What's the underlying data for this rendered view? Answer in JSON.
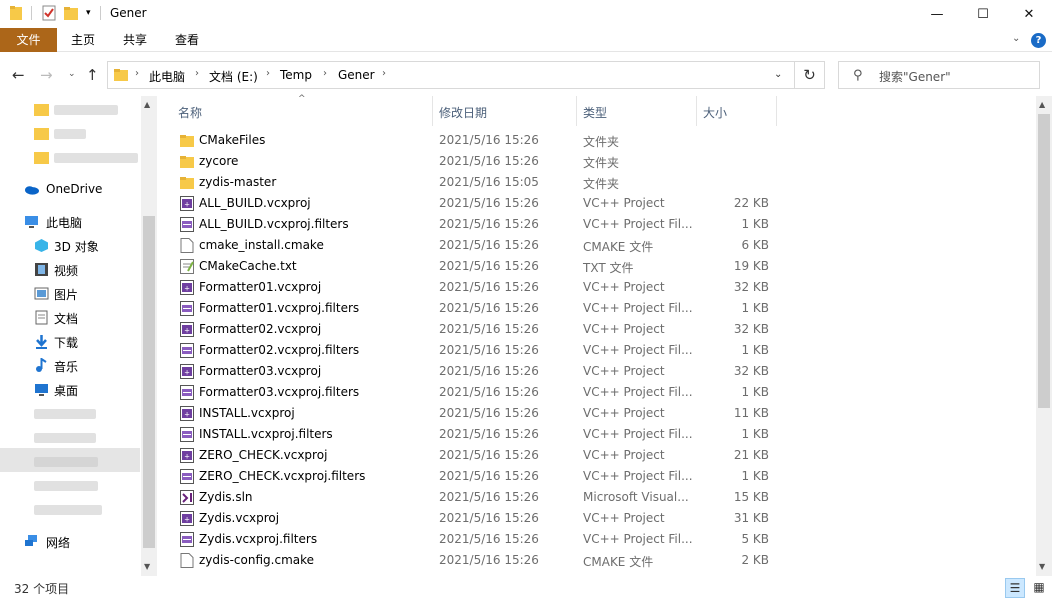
{
  "window": {
    "title": "Gener",
    "minimize": "—",
    "maximize": "☐",
    "close": "✕",
    "dropdown_glyph": "▾"
  },
  "ribbon": {
    "tabs": [
      "文件",
      "主页",
      "共享",
      "查看"
    ],
    "expand_glyph": "⌄",
    "help": "?"
  },
  "nav": {
    "back": "←",
    "forward": "→",
    "recent": "⌄",
    "up": "↑",
    "refresh": "↻",
    "breadcrumb": [
      "此电脑",
      "文档 (E:)",
      "Temp",
      "Gener"
    ],
    "crumb_sep": "›",
    "address_dropdown": "⌄"
  },
  "search": {
    "placeholder": "搜索\"Gener\""
  },
  "navpane": {
    "items": [
      {
        "label": "OneDrive",
        "icon": "onedrive-icon"
      },
      {
        "label": "此电脑",
        "icon": "this-pc-icon"
      },
      {
        "label": "3D 对象",
        "icon": "3d-objects-icon"
      },
      {
        "label": "视频",
        "icon": "videos-icon"
      },
      {
        "label": "图片",
        "icon": "pictures-icon"
      },
      {
        "label": "文档",
        "icon": "documents-icon"
      },
      {
        "label": "下载",
        "icon": "downloads-icon"
      },
      {
        "label": "音乐",
        "icon": "music-icon"
      },
      {
        "label": "桌面",
        "icon": "desktop-icon"
      },
      {
        "label": "网络",
        "icon": "network-icon"
      }
    ]
  },
  "columns": {
    "name": "名称",
    "date": "修改日期",
    "type": "类型",
    "size": "大小",
    "sort_glyph": "^"
  },
  "files": [
    {
      "name": "CMakeFiles",
      "date": "2021/5/16 15:26",
      "type": "文件夹",
      "size": "",
      "icon": "folder"
    },
    {
      "name": "zycore",
      "date": "2021/5/16 15:26",
      "type": "文件夹",
      "size": "",
      "icon": "folder"
    },
    {
      "name": "zydis-master",
      "date": "2021/5/16 15:05",
      "type": "文件夹",
      "size": "",
      "icon": "folder"
    },
    {
      "name": "ALL_BUILD.vcxproj",
      "date": "2021/5/16 15:26",
      "type": "VC++ Project",
      "size": "22 KB",
      "icon": "vcxproj"
    },
    {
      "name": "ALL_BUILD.vcxproj.filters",
      "date": "2021/5/16 15:26",
      "type": "VC++ Project Fil...",
      "size": "1 KB",
      "icon": "filters"
    },
    {
      "name": "cmake_install.cmake",
      "date": "2021/5/16 15:26",
      "type": "CMAKE 文件",
      "size": "6 KB",
      "icon": "file"
    },
    {
      "name": "CMakeCache.txt",
      "date": "2021/5/16 15:26",
      "type": "TXT 文件",
      "size": "19 KB",
      "icon": "txt"
    },
    {
      "name": "Formatter01.vcxproj",
      "date": "2021/5/16 15:26",
      "type": "VC++ Project",
      "size": "32 KB",
      "icon": "vcxproj"
    },
    {
      "name": "Formatter01.vcxproj.filters",
      "date": "2021/5/16 15:26",
      "type": "VC++ Project Fil...",
      "size": "1 KB",
      "icon": "filters"
    },
    {
      "name": "Formatter02.vcxproj",
      "date": "2021/5/16 15:26",
      "type": "VC++ Project",
      "size": "32 KB",
      "icon": "vcxproj"
    },
    {
      "name": "Formatter02.vcxproj.filters",
      "date": "2021/5/16 15:26",
      "type": "VC++ Project Fil...",
      "size": "1 KB",
      "icon": "filters"
    },
    {
      "name": "Formatter03.vcxproj",
      "date": "2021/5/16 15:26",
      "type": "VC++ Project",
      "size": "32 KB",
      "icon": "vcxproj"
    },
    {
      "name": "Formatter03.vcxproj.filters",
      "date": "2021/5/16 15:26",
      "type": "VC++ Project Fil...",
      "size": "1 KB",
      "icon": "filters"
    },
    {
      "name": "INSTALL.vcxproj",
      "date": "2021/5/16 15:26",
      "type": "VC++ Project",
      "size": "11 KB",
      "icon": "vcxproj"
    },
    {
      "name": "INSTALL.vcxproj.filters",
      "date": "2021/5/16 15:26",
      "type": "VC++ Project Fil...",
      "size": "1 KB",
      "icon": "filters"
    },
    {
      "name": "ZERO_CHECK.vcxproj",
      "date": "2021/5/16 15:26",
      "type": "VC++ Project",
      "size": "21 KB",
      "icon": "vcxproj"
    },
    {
      "name": "ZERO_CHECK.vcxproj.filters",
      "date": "2021/5/16 15:26",
      "type": "VC++ Project Fil...",
      "size": "1 KB",
      "icon": "filters"
    },
    {
      "name": "Zydis.sln",
      "date": "2021/5/16 15:26",
      "type": "Microsoft Visual...",
      "size": "15 KB",
      "icon": "sln"
    },
    {
      "name": "Zydis.vcxproj",
      "date": "2021/5/16 15:26",
      "type": "VC++ Project",
      "size": "31 KB",
      "icon": "vcxproj"
    },
    {
      "name": "Zydis.vcxproj.filters",
      "date": "2021/5/16 15:26",
      "type": "VC++ Project Fil...",
      "size": "5 KB",
      "icon": "filters"
    },
    {
      "name": "zydis-config.cmake",
      "date": "2021/5/16 15:26",
      "type": "CMAKE 文件",
      "size": "2 KB",
      "icon": "file"
    }
  ],
  "status": {
    "count": "32 个项目"
  },
  "colors": {
    "file_tab": "#ac6619",
    "folder": "#f7c948",
    "header_text": "#4c607a",
    "accent_blue": "#1a6bc6"
  }
}
